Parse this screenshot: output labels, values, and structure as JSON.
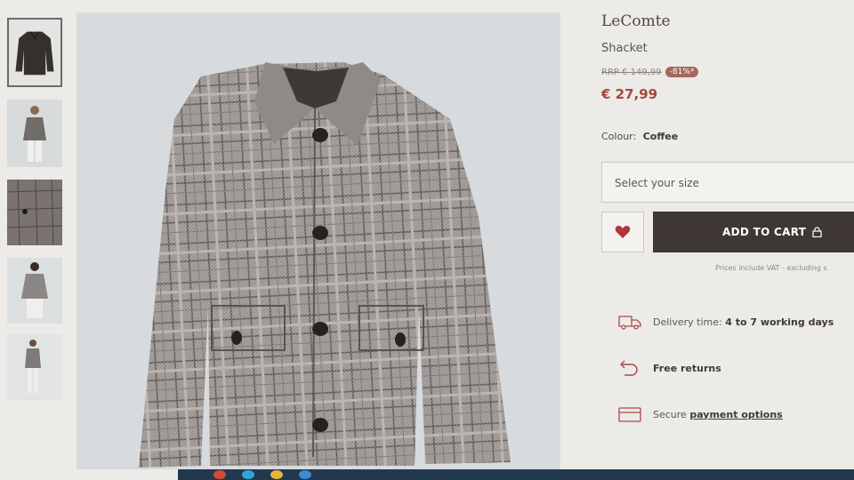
{
  "thumbnails": [
    {
      "name": "thumbnail-front-flat",
      "active": true
    },
    {
      "name": "thumbnail-model-front",
      "active": false
    },
    {
      "name": "thumbnail-fabric-detail",
      "active": false
    },
    {
      "name": "thumbnail-model-back",
      "active": false
    },
    {
      "name": "thumbnail-model-full",
      "active": false
    }
  ],
  "product": {
    "brand": "LeComte",
    "name": "Shacket",
    "rrp": "RRP € 149,99",
    "discount": "-81%*",
    "price": "€ 27,99",
    "colour_label": "Colour:",
    "colour_value": "Coffee"
  },
  "size_select": {
    "placeholder": "Select your size"
  },
  "buttons": {
    "wishlist_icon": "heart-icon",
    "add_to_cart": "ADD TO CART",
    "cart_icon": "lock-icon"
  },
  "vat_note": "Prices include VAT - excluding s",
  "features": {
    "delivery": {
      "icon": "truck-icon",
      "label": "Delivery time:",
      "value": "4 to 7 working days"
    },
    "returns": {
      "icon": "return-arrow-icon",
      "label": "Free returns"
    },
    "payment": {
      "icon": "credit-card-icon",
      "label": "Secure",
      "link": "payment options"
    }
  },
  "colors": {
    "price": "#a6473f",
    "discount_badge": "#a4685c",
    "cart_button": "#3e3733",
    "heart": "#b3343c"
  }
}
